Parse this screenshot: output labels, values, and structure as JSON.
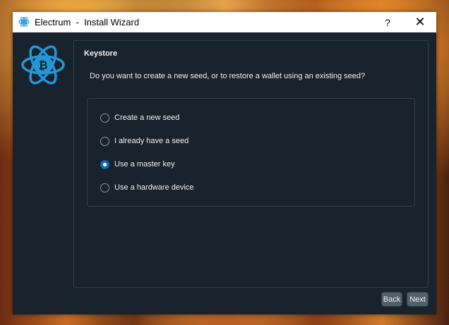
{
  "window": {
    "title": "Electrum  -  Install Wizard",
    "help_label": "?",
    "close_label": "✕"
  },
  "page": {
    "section_title": "Keystore",
    "question": "Do you want to create a new seed, or to restore a wallet using an existing seed?"
  },
  "options": [
    {
      "label": "Create a new seed",
      "checked": false
    },
    {
      "label": "I already have a seed",
      "checked": false
    },
    {
      "label": "Use a master key",
      "checked": true
    },
    {
      "label": "Use a hardware device",
      "checked": false
    }
  ],
  "buttons": {
    "back_label": "Back",
    "next_label": "Next"
  },
  "icons": {
    "app": "electrum-icon",
    "logo": "electrum-logo-icon"
  },
  "colors": {
    "accent": "#1e74b8",
    "background": "#19232d",
    "border": "#32414b",
    "button": "#505f69",
    "logo_blue": "#2496d6"
  }
}
